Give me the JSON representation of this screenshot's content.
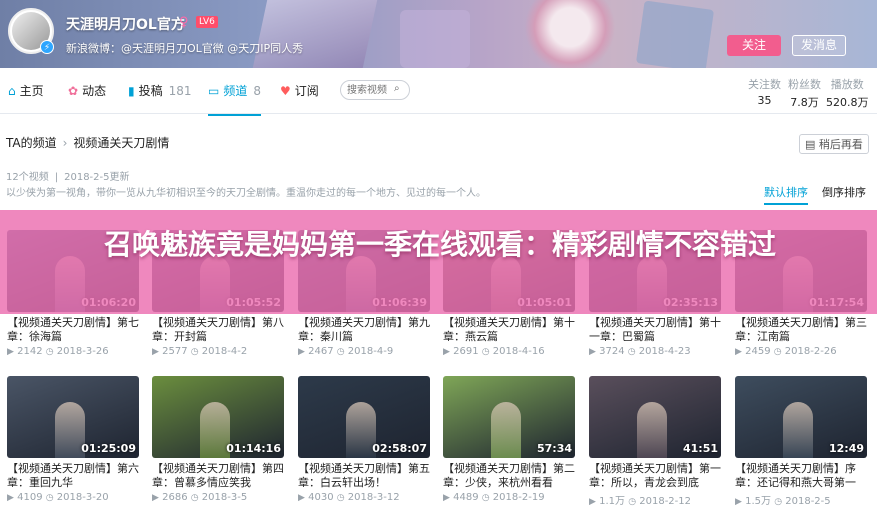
{
  "header": {
    "username": "天涯明月刀OL官方",
    "gender_icon": "♀",
    "level": "LV6",
    "sign": "新浪微博：@天涯明月刀OL官微 @天刀IP同人秀",
    "follow_label": "关注",
    "message_label": "发消息"
  },
  "nav": {
    "items": [
      {
        "label": "主页",
        "count": "",
        "icon": "home-icon"
      },
      {
        "label": "动态",
        "count": "",
        "icon": "flower-icon"
      },
      {
        "label": "投稿",
        "count": "181",
        "icon": "upload-icon"
      },
      {
        "label": "频道",
        "count": "8",
        "icon": "channel-icon"
      },
      {
        "label": "订阅",
        "count": "",
        "icon": "heart-icon"
      }
    ],
    "search_placeholder": "搜索视频",
    "stats": [
      {
        "label": "关注数",
        "value": "35"
      },
      {
        "label": "粉丝数",
        "value": "7.8万"
      },
      {
        "label": "播放数",
        "value": "520.8万"
      }
    ]
  },
  "channel": {
    "crumb_root": "TA的频道",
    "crumb_sep": "›",
    "crumb_current": "视频通关天刀剧情",
    "watch_later": "稍后再看",
    "video_count": "12个视频",
    "updated": "2018-2-5更新",
    "meta_sep": "|",
    "description": "以少侠为第一视角，带你一览从九华初相识至今的天刀全剧情。重温你走过的每一个地方、见过的每一个人。",
    "sort_default": "默认排序",
    "sort_reverse": "倒序排序"
  },
  "overlay": {
    "text": "召唤魅族竟是妈妈第一季在线观看：精彩剧情不容错过"
  },
  "videos": [
    {
      "title": "【视频通关天刀剧情】第七章：徐海篇",
      "plays": "2142",
      "date": "2018-3-26",
      "duration": "01:06:20",
      "color": "#5a6b8c"
    },
    {
      "title": "【视频通关天刀剧情】第八章：开封篇",
      "plays": "2577",
      "date": "2018-4-2",
      "duration": "01:05:52",
      "color": "#6b5a7c"
    },
    {
      "title": "【视频通关天刀剧情】第九章：秦川篇",
      "plays": "2467",
      "date": "2018-4-9",
      "duration": "01:06:39",
      "color": "#4c5f78"
    },
    {
      "title": "【视频通关天刀剧情】第十章：燕云篇",
      "plays": "2691",
      "date": "2018-4-16",
      "duration": "01:05:01",
      "color": "#7a6a5a"
    },
    {
      "title": "【视频通关天刀剧情】第十一章：巴蜀篇",
      "plays": "3724",
      "date": "2018-4-23",
      "duration": "02:35:13",
      "color": "#5c4d6e"
    },
    {
      "title": "【视频通关天刀剧情】第三章：江南篇",
      "plays": "2459",
      "date": "2018-2-26",
      "duration": "01:17:54",
      "color": "#6e5c78"
    },
    {
      "title": "【视频通关天刀剧情】第六章：重回九华",
      "plays": "4109",
      "date": "2018-3-20",
      "duration": "01:25:09",
      "color": "#4a5566"
    },
    {
      "title": "【视频通关天刀剧情】第四章：曾慕多情应笑我",
      "plays": "2686",
      "date": "2018-3-5",
      "duration": "01:14:16",
      "color": "#6b8e3e"
    },
    {
      "title": "【视频通关天刀剧情】第五章：白云轩出场！",
      "plays": "4030",
      "date": "2018-3-12",
      "duration": "02:58:07",
      "color": "#2d3a4a"
    },
    {
      "title": "【视频通关天刀剧情】第二章：少侠，来杭州看看",
      "plays": "4489",
      "date": "2018-2-19",
      "duration": "57:34",
      "color": "#7fa657"
    },
    {
      "title": "【视频通关天刀剧情】第一章：所以，青龙会到底",
      "plays": "1.1万",
      "date": "2018-2-12",
      "duration": "41:51",
      "color": "#5a4f5c"
    },
    {
      "title": "【视频通关天刀剧情】序章：还记得和燕大哥第一",
      "plays": "1.5万",
      "date": "2018-2-5",
      "duration": "12:49",
      "color": "#3e4d5e"
    }
  ],
  "colors": {
    "accent": "#00a1d6",
    "follow": "#f25d8e",
    "overlay": "#ec6eb0"
  }
}
